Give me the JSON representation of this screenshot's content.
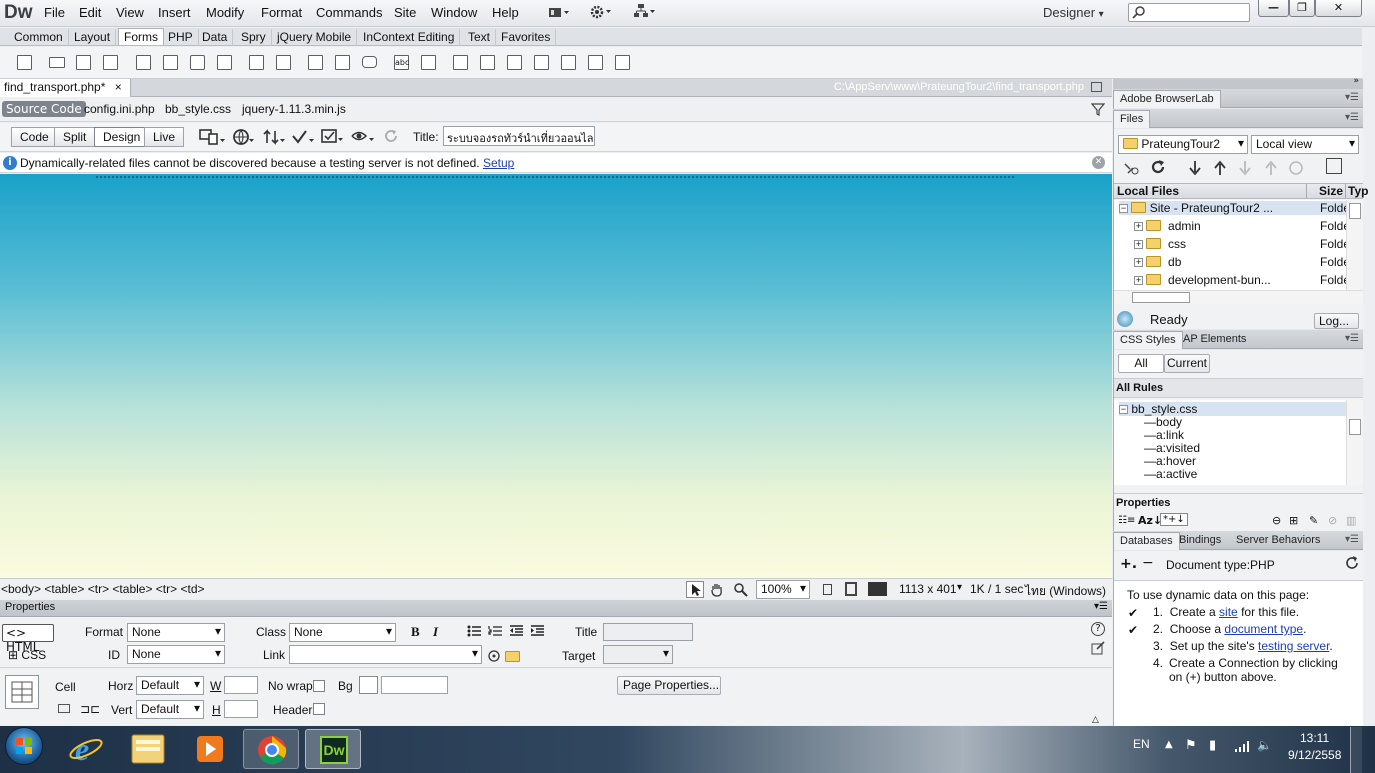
{
  "menubar": {
    "logo": "Dw",
    "items": [
      "File",
      "Edit",
      "View",
      "Insert",
      "Modify",
      "Format",
      "Commands",
      "Site",
      "Window",
      "Help"
    ],
    "workspace": "Designer",
    "workspace_caret": "▾",
    "search_icon": "magnifier-icon",
    "window_buttons": {
      "minimize": "—",
      "restore": "❐",
      "close": "✕"
    }
  },
  "insert": {
    "tabs": [
      "Common",
      "Layout",
      "Forms",
      "PHP",
      "Data",
      "Spry",
      "jQuery Mobile",
      "InContext Editing",
      "Text",
      "Favorites"
    ],
    "active_tab": "Forms"
  },
  "document": {
    "tab_name": "find_transport.php*",
    "tab_close": "×",
    "path": "C:\\AppServ\\www\\PrateungTour2\\find_transport.php",
    "source_code": "Source Code",
    "related_files": [
      "config.ini.php",
      "bb_style.css",
      "jquery-1.11.3.min.js"
    ],
    "views": [
      "Code",
      "Split",
      "Design",
      "Live"
    ],
    "active_view": "Design",
    "title_label": "Title:",
    "title_value": "ระบบจองรถทัวร์นำเที่ยวออนไลน์",
    "info_message": "Dynamically-related files cannot be discovered because a testing server is not defined.",
    "info_link": "Setup",
    "info_icon": "info-icon"
  },
  "status": {
    "tag_selector": "<body> <table> <tr> <table> <tr> <td>",
    "zoom": "100%",
    "window_size": "1113 x 401",
    "download": "1K / 1 sec",
    "encoding": "ไทย (Windows)"
  },
  "properties": {
    "header": "Properties",
    "html_btn": "HTML",
    "css_btn": "CSS",
    "format_label": "Format",
    "format_value": "None",
    "class_label": "Class",
    "class_value": "None",
    "id_label": "ID",
    "id_value": "None",
    "link_label": "Link",
    "title_label": "Title",
    "target_label": "Target",
    "bold": "B",
    "italic": "I",
    "cell_label": "Cell",
    "horz_label": "Horz",
    "horz_value": "Default",
    "vert_label": "Vert",
    "vert_value": "Default",
    "w_label": "W",
    "h_label": "H",
    "nowrap_label": "No wrap",
    "bg_label": "Bg",
    "header_label": "Header",
    "page_props": "Page Properties..."
  },
  "right": {
    "browserlab": "Adobe BrowserLab",
    "files_tab": "Files",
    "site_select": "PrateungTour2",
    "view_select": "Local view",
    "cols": {
      "name": "Local Files",
      "size": "Size",
      "type": "Typ"
    },
    "tree": [
      {
        "name": "Site - PrateungTour2 ...",
        "type": "Folde"
      },
      {
        "name": "admin",
        "type": "Folde"
      },
      {
        "name": "css",
        "type": "Folde"
      },
      {
        "name": "db",
        "type": "Folde"
      },
      {
        "name": "development-bun...",
        "type": "Folde"
      }
    ],
    "ready": "Ready",
    "log": "Log...",
    "css_tabs": [
      "CSS Styles",
      "AP Elements"
    ],
    "css_buttons": [
      "All",
      "Current"
    ],
    "all_rules": "All Rules",
    "css_file": "bb_style.css",
    "rules": [
      "body",
      "a:link",
      "a:visited",
      "a:hover",
      "a:active"
    ],
    "props_label": "Properties",
    "db_tabs": [
      "Databases",
      "Bindings",
      "Server Behaviors"
    ],
    "doc_type": "Document type:PHP",
    "instructions_title": "To use dynamic data on this page:",
    "steps": [
      {
        "num": "1.",
        "pre": "Create a ",
        "link": "site",
        "post": " for this file.",
        "checked": true
      },
      {
        "num": "2.",
        "pre": "Choose a ",
        "link": "document type",
        "post": ".",
        "checked": true
      },
      {
        "num": "3.",
        "pre": "Set up the site's ",
        "link": "testing server",
        "post": ".",
        "checked": false
      },
      {
        "num": "4.",
        "pre": "Create a Connection by clicking on (+) button above.",
        "link": "",
        "post": "",
        "checked": false
      }
    ]
  },
  "taskbar": {
    "lang": "EN",
    "time": "13:11",
    "date": "9/12/2558",
    "apps": [
      "ie-icon",
      "explorer-icon",
      "media-player-icon",
      "chrome-icon",
      "dreamweaver-icon"
    ],
    "dw_label": "Dw"
  }
}
